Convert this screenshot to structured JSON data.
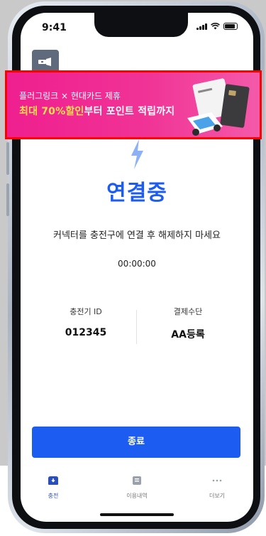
{
  "status_bar": {
    "time": "9:41"
  },
  "banner": {
    "line1": "플러그링크 × 현대카드 제휴",
    "line2_highlight": "최대 70%할인",
    "line2_rest": "부터 포인트 적립까지"
  },
  "main": {
    "title": "연결중",
    "subtitle": "커넥터를 충전구에 연결 후 해제하지 마세요",
    "timer": "00:00:00",
    "charger_id_label": "충전기 ID",
    "charger_id_value": "012345",
    "payment_label": "결제수단",
    "payment_value": "AA등록"
  },
  "end_button": {
    "label": "종료"
  },
  "tabbar": {
    "items": [
      {
        "label": "충전",
        "icon": "charge-icon",
        "active": true
      },
      {
        "label": "이용내역",
        "icon": "history-icon",
        "active": false
      },
      {
        "label": "더보기",
        "icon": "more-icon",
        "active": false
      }
    ]
  },
  "colors": {
    "accent": "#1d5cf0",
    "banner": "#ef1f8f",
    "banner_highlight": "#ffe14a",
    "highlight_border": "#ff0000"
  }
}
